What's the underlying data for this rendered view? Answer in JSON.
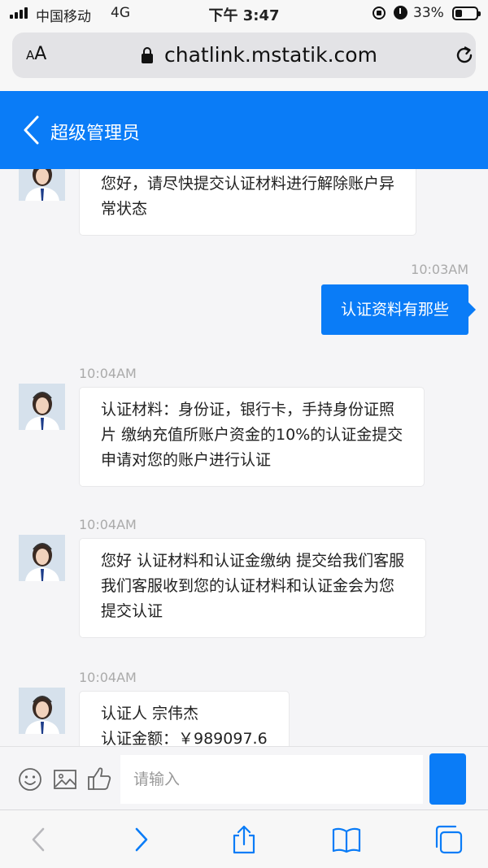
{
  "status_bar": {
    "carrier": "中国移动",
    "network": "4G",
    "time": "下午 3:47",
    "battery_percent": "33%",
    "battery_level": 0.33,
    "icons": [
      "signal-icon",
      "rotation-lock-icon",
      "alarm-icon",
      "battery-icon"
    ]
  },
  "browser": {
    "reader_label_small": "A",
    "reader_label_large": "A",
    "url": "chatlink.mstatik.com",
    "icons": [
      "padlock-icon",
      "reload-icon"
    ]
  },
  "chat": {
    "title": "超级管理员",
    "messages": [
      {
        "from": "agent",
        "time": "",
        "text": [
          "您好，请尽快提交认证材料进行解除账户异",
          "常状态"
        ]
      },
      {
        "from": "user",
        "time": "10:03AM",
        "text": [
          "认证资料有那些"
        ]
      },
      {
        "from": "agent",
        "time": "10:04AM",
        "text": [
          "认证材料：身份证，银行卡，手持身份证照",
          "片 缴纳充值所账户资金的10%的认证金提交",
          "申请对您的账户进行认证"
        ]
      },
      {
        "from": "agent",
        "time": "10:04AM",
        "text": [
          "您好 认证材料和认证金缴纳 提交给我们客服",
          "我们客服收到您的认证材料和认证金会为您",
          "提交认证"
        ]
      },
      {
        "from": "agent",
        "time": "10:04AM",
        "text": [
          "认证人 宗伟杰",
          "认证金额：￥989097.6"
        ]
      }
    ]
  },
  "input_bar": {
    "placeholder": "请输入",
    "icons": [
      "emoji-icon",
      "image-icon",
      "thumbs-up-icon"
    ]
  },
  "toolbar": {
    "icons": [
      "back-arrow-icon",
      "forward-arrow-icon",
      "share-icon",
      "bookmarks-icon",
      "tabs-icon"
    ]
  },
  "colors": {
    "accent": "#0a7cf7",
    "background": "#f5f5f7"
  }
}
